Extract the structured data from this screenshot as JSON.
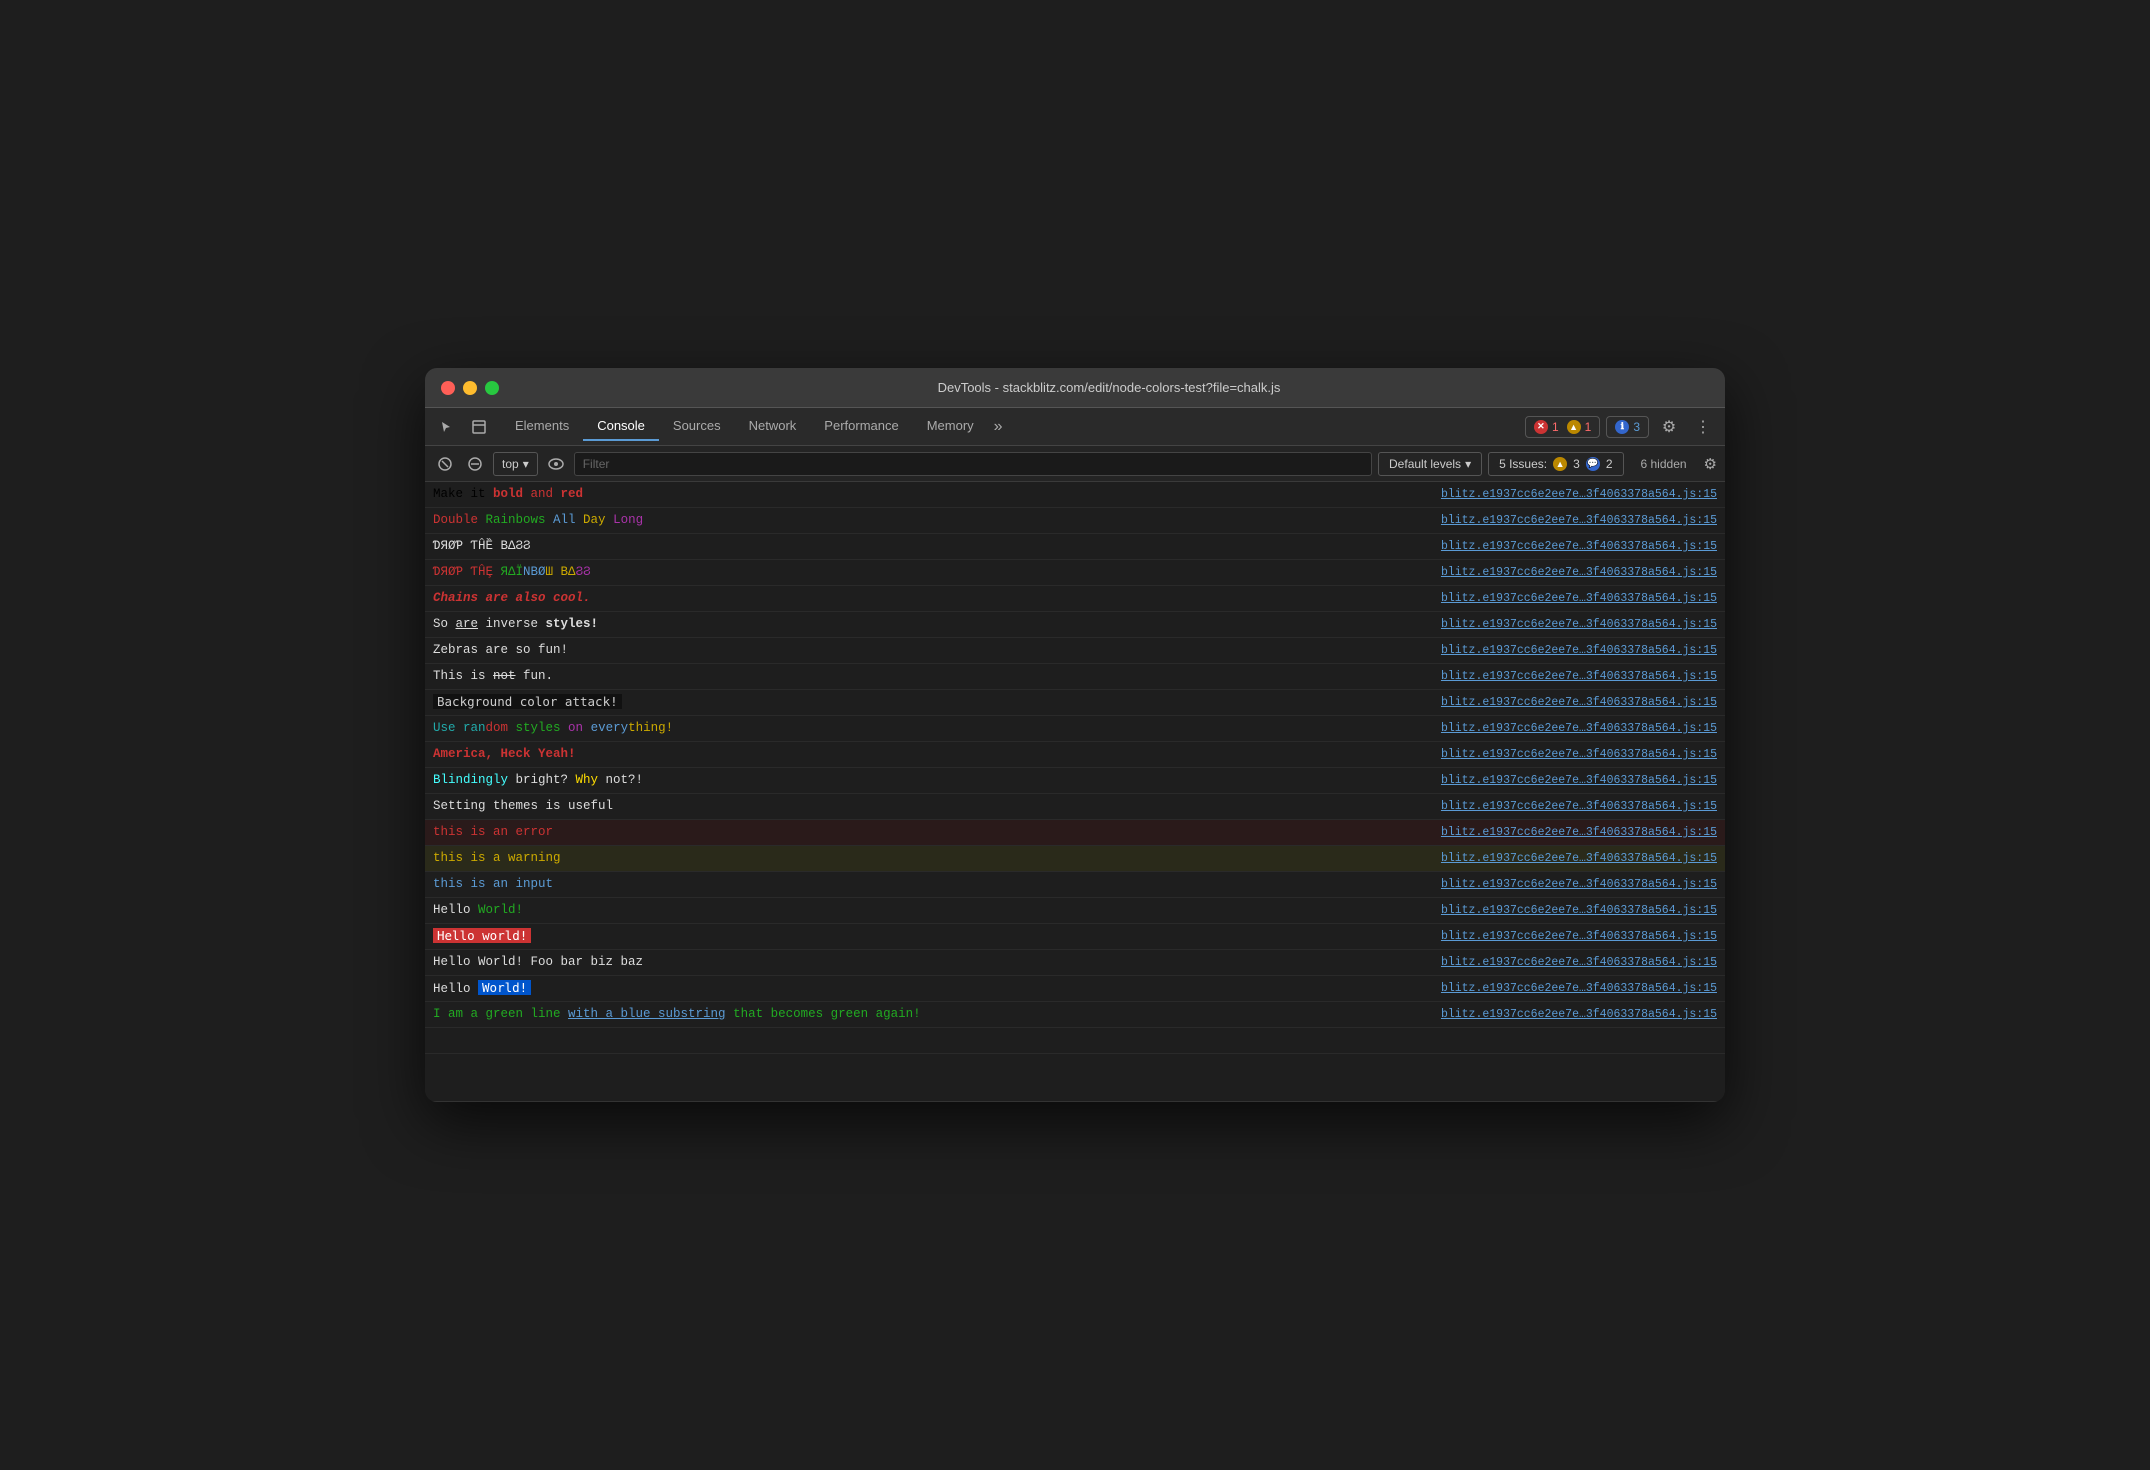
{
  "window": {
    "title": "DevTools - stackblitz.com/edit/node-colors-test?file=chalk.js",
    "traffic_lights": [
      "red",
      "yellow",
      "green"
    ]
  },
  "tabs": {
    "items": [
      {
        "label": "Elements",
        "active": false
      },
      {
        "label": "Console",
        "active": true
      },
      {
        "label": "Sources",
        "active": false
      },
      {
        "label": "Network",
        "active": false
      },
      {
        "label": "Performance",
        "active": false
      },
      {
        "label": "Memory",
        "active": false
      }
    ],
    "more_label": "»"
  },
  "toolbar": {
    "top_label": "top",
    "filter_placeholder": "Filter",
    "levels_label": "Default levels",
    "issues_label": "5 Issues:",
    "issues_warn_count": "3",
    "issues_info_count": "2",
    "hidden_label": "6 hidden"
  },
  "badges": {
    "error_count": "1",
    "warn_count": "1",
    "info_count": "3"
  },
  "source_ref": "blitz.e1937cc6e2ee7e…3f4063378a564.js:15",
  "console_rows": [
    {
      "id": 1,
      "type": "normal",
      "parts": [
        {
          "text": "Make it ",
          "style": ""
        },
        {
          "text": "bold",
          "style": "c-red t-bold"
        },
        {
          "text": " and ",
          "style": "c-red"
        },
        {
          "text": "red",
          "style": "c-red t-bold"
        }
      ]
    },
    {
      "id": 2,
      "type": "normal",
      "parts": [
        {
          "text": "Double ",
          "style": "c-red"
        },
        {
          "text": "Rainbows",
          "style": "c-green"
        },
        {
          "text": " All ",
          "style": "c-blue"
        },
        {
          "text": "Day",
          "style": "c-yellow"
        },
        {
          "text": " Long",
          "style": "c-magenta"
        }
      ]
    },
    {
      "id": 3,
      "type": "normal",
      "parts": [
        {
          "text": "ƊЯØƤ ƬĤȄ ΒΔϨϨ",
          "style": "c-white"
        }
      ]
    },
    {
      "id": 4,
      "type": "normal",
      "parts": [
        {
          "text": "ƊЯØƤ ƬĤȨ ",
          "style": "c-red"
        },
        {
          "text": "ЯΔЇ",
          "style": "c-green"
        },
        {
          "text": "ΝΒØ",
          "style": "c-blue"
        },
        {
          "text": "Ш ΒΔ",
          "style": "c-yellow"
        },
        {
          "text": "ϨϨ",
          "style": "c-magenta"
        }
      ]
    },
    {
      "id": 5,
      "type": "normal",
      "parts": [
        {
          "text": "Chains are also cool. ",
          "style": "c-red t-italic t-bold"
        }
      ]
    },
    {
      "id": 6,
      "type": "normal",
      "parts": [
        {
          "text": "So ",
          "style": "c-white"
        },
        {
          "text": "are",
          "style": "c-white t-underline"
        },
        {
          "text": " inverse ",
          "style": "c-white"
        },
        {
          "text": "styles!",
          "style": "c-white t-bold"
        }
      ]
    },
    {
      "id": 7,
      "type": "normal",
      "parts": [
        {
          "text": "Zebras are so fun!",
          "style": "c-white"
        }
      ]
    },
    {
      "id": 8,
      "type": "normal",
      "parts": [
        {
          "text": "This is ",
          "style": "c-white"
        },
        {
          "text": "not",
          "style": "c-white t-strikethrough"
        },
        {
          "text": " fun.",
          "style": "c-white"
        }
      ]
    },
    {
      "id": 9,
      "type": "normal",
      "parts": [
        {
          "text": "Background color attack!",
          "style": "bg-black c-white",
          "boxed": true
        }
      ]
    },
    {
      "id": 10,
      "type": "normal",
      "parts": [
        {
          "text": "Use ran",
          "style": "c-cyan"
        },
        {
          "text": "dom",
          "style": "c-red"
        },
        {
          "text": " styles ",
          "style": "c-green"
        },
        {
          "text": "on",
          "style": "c-magenta"
        },
        {
          "text": " every",
          "style": "c-blue"
        },
        {
          "text": "thing!",
          "style": "c-yellow"
        }
      ]
    },
    {
      "id": 11,
      "type": "normal",
      "parts": [
        {
          "text": "America, Heck Yeah!",
          "style": "c-red t-bold"
        }
      ]
    },
    {
      "id": 12,
      "type": "normal",
      "parts": [
        {
          "text": "Blindingly ",
          "style": "c-bright-cyan"
        },
        {
          "text": "bright? ",
          "style": "c-white"
        },
        {
          "text": "Why",
          "style": "c-bright-yellow"
        },
        {
          "text": " not?!",
          "style": "c-white"
        }
      ]
    },
    {
      "id": 13,
      "type": "normal",
      "parts": [
        {
          "text": "Setting themes is useful",
          "style": "c-white"
        }
      ]
    },
    {
      "id": 14,
      "type": "error",
      "parts": [
        {
          "text": "this is an error",
          "style": "c-red"
        }
      ]
    },
    {
      "id": 15,
      "type": "warn",
      "parts": [
        {
          "text": "this is a warning",
          "style": "c-yellow"
        }
      ]
    },
    {
      "id": 16,
      "type": "normal",
      "parts": [
        {
          "text": "this is an input",
          "style": "c-blue"
        }
      ]
    },
    {
      "id": 17,
      "type": "normal",
      "parts": [
        {
          "text": "Hello ",
          "style": "c-white"
        },
        {
          "text": "World!",
          "style": "c-green"
        }
      ]
    },
    {
      "id": 18,
      "type": "normal",
      "parts": [
        {
          "text": "Hello world!",
          "style": "bg-red c-white",
          "boxed": true
        }
      ]
    },
    {
      "id": 19,
      "type": "normal",
      "parts": [
        {
          "text": "Hello World! Foo bar biz baz",
          "style": "c-white"
        }
      ]
    },
    {
      "id": 20,
      "type": "normal",
      "parts": [
        {
          "text": "Hello ",
          "style": "c-white"
        },
        {
          "text": "World!",
          "style": "bg-blue c-white",
          "boxed": true
        }
      ]
    },
    {
      "id": 21,
      "type": "normal",
      "parts": [
        {
          "text": "I am a green line ",
          "style": "c-green"
        },
        {
          "text": "with a blue substring",
          "style": "c-blue t-underline"
        },
        {
          "text": " that becomes green again!",
          "style": "c-green"
        }
      ]
    },
    {
      "id": 22,
      "type": "normal",
      "parts": [
        {
          "text": "",
          "style": ""
        }
      ]
    }
  ]
}
